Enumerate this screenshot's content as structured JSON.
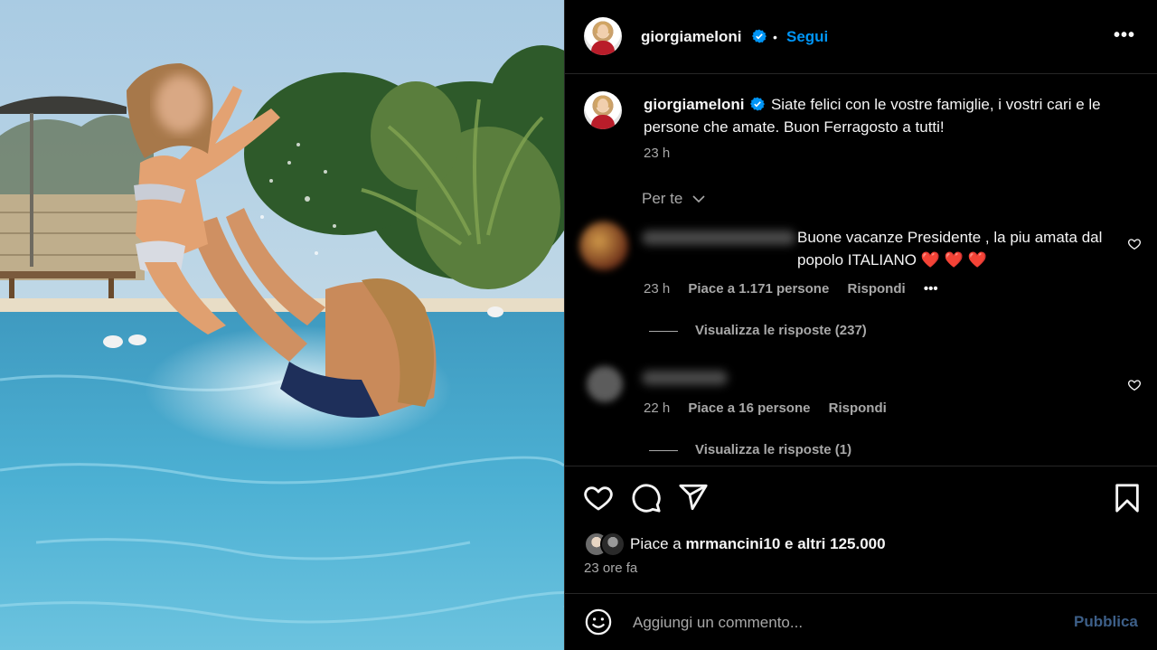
{
  "post": {
    "username": "giorgiameloni",
    "follow_label": "Segui",
    "dot": "•",
    "more_label": "•••"
  },
  "caption": {
    "username": "giorgiameloni",
    "text": "Siate felici con le vostre famiglie, i vostri cari e le persone che amate. Buon Ferragosto a tutti!",
    "time": "23 h"
  },
  "sort_label": "Per te",
  "comments": [
    {
      "text": "Buone vacanze Presidente , la piu amata dal popolo ITALIANO",
      "emoji": "❤️ ❤️ ❤️",
      "time": "23 h",
      "likes": "Piace a 1.171 persone",
      "reply": "Rispondi",
      "options": "•••",
      "view_replies": "Visualizza le risposte (237)"
    },
    {
      "time": "22 h",
      "likes": "Piace a 16 persone",
      "reply": "Rispondi",
      "view_replies": "Visualizza le risposte (1)"
    }
  ],
  "likes": {
    "prefix": "Piace a ",
    "user": "mrmancini10",
    "suffix": " e altri 125.000"
  },
  "time_ago": "23 ore fa",
  "composer": {
    "placeholder": "Aggiungi un commento...",
    "publish_label": "Pubblica"
  },
  "colors": {
    "accent": "#0095f6",
    "publish_disabled": "#3d5f88",
    "heart_red": "#e0293b",
    "muted": "#a8a8a8"
  },
  "icons": [
    "verified-badge-icon",
    "heart-icon",
    "comment-icon",
    "share-icon",
    "bookmark-icon",
    "emoji-icon",
    "more-icon"
  ]
}
